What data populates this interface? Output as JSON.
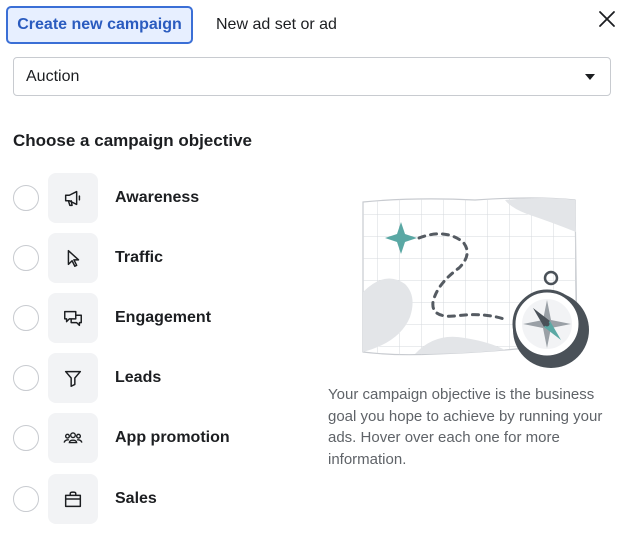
{
  "tabs": {
    "active_label": "Create new campaign",
    "inactive_label": "New ad set or ad"
  },
  "buying_type": {
    "selected": "Auction"
  },
  "heading": "Choose a campaign objective",
  "objectives": [
    {
      "label": "Awareness",
      "icon": "megaphone-icon"
    },
    {
      "label": "Traffic",
      "icon": "cursor-icon"
    },
    {
      "label": "Engagement",
      "icon": "chat-bubbles-icon"
    },
    {
      "label": "Leads",
      "icon": "funnel-icon"
    },
    {
      "label": "App promotion",
      "icon": "people-icon"
    },
    {
      "label": "Sales",
      "icon": "shopping-bag-icon"
    }
  ],
  "description": "Your campaign objective is the business goal you hope to achieve by running your ads. Hover over each one for more information.",
  "colors": {
    "accent": "#3b6fd6",
    "accent_bg": "#e7efff",
    "map_star": "#5aa8a4",
    "compass_dark": "#4a5158"
  }
}
